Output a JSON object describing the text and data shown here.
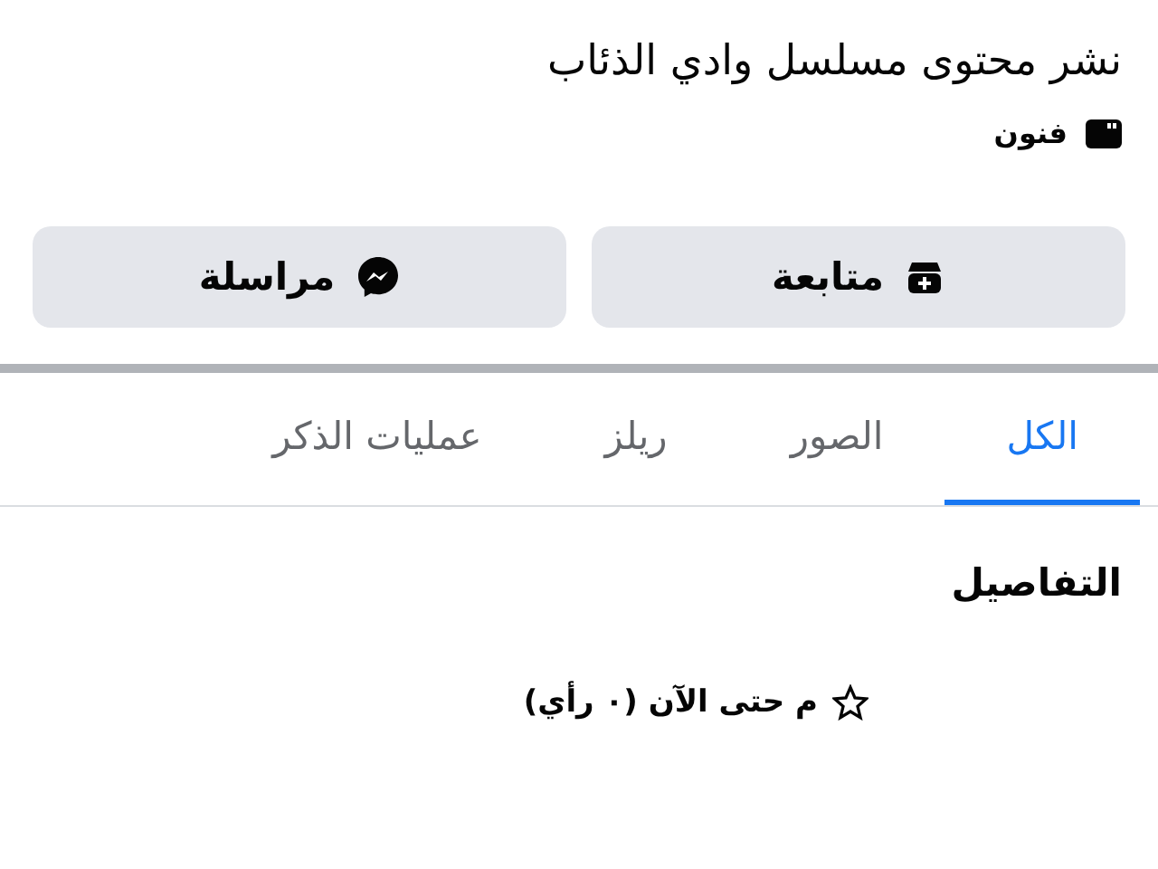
{
  "page": {
    "title": "نشر محتوى مسلسل وادي الذئاب",
    "category": "فنون"
  },
  "buttons": [
    {
      "label": "متابعة",
      "kind": "follow"
    },
    {
      "label": "مراسلة",
      "kind": "message"
    }
  ],
  "tabs": [
    {
      "label": "الكل",
      "selected": true
    },
    {
      "label": "الصور",
      "selected": false
    },
    {
      "label": "ريلز",
      "selected": false
    },
    {
      "label": "عمليات الذكر",
      "selected": false
    }
  ],
  "details": {
    "heading": "التفاصيل",
    "rating": "م حتى الآن (٠ رأي)"
  }
}
